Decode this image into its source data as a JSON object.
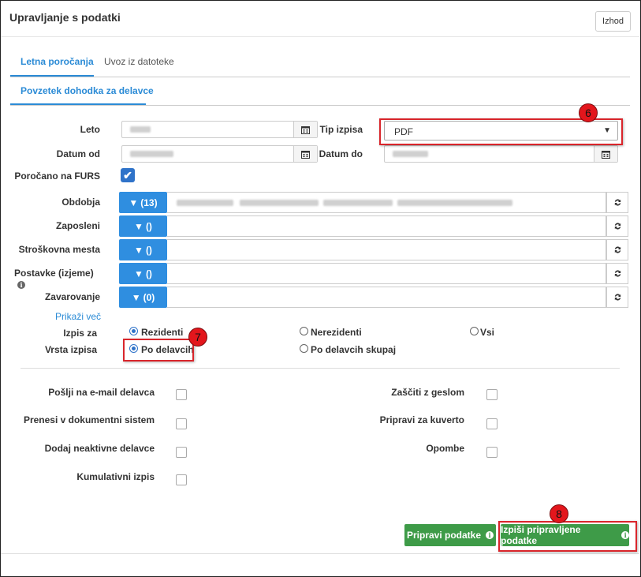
{
  "header": {
    "title": "Upravljanje s podatki",
    "exit_label": "Izhod"
  },
  "tabs": [
    {
      "label": "Letna poročanja"
    },
    {
      "label": "Uvoz iz datoteke"
    }
  ],
  "subtab": {
    "label": "Povzetek dohodka za delavce"
  },
  "form": {
    "leto_label": "Leto",
    "tip_izpisa_label": "Tip izpisa",
    "tip_izpisa_value": "PDF",
    "datum_od_label": "Datum od",
    "datum_do_label": "Datum do",
    "furs_label": "Poročano na FURS",
    "furs_check": "✔"
  },
  "filters": [
    {
      "label": "Obdobja",
      "count": "(13)"
    },
    {
      "label": "Zaposleni",
      "count": "()"
    },
    {
      "label": "Stroškovna mesta",
      "count": "()"
    },
    {
      "label": "Postavke (izjeme)",
      "count": "()"
    },
    {
      "label": "Zavarovanje",
      "count": "(0)"
    }
  ],
  "show_more": "Prikaži več",
  "izpis_za": {
    "label": "Izpis za",
    "options": [
      "Rezidenti",
      "Nerezidenti",
      "Vsi"
    ]
  },
  "vrsta_izpisa": {
    "label": "Vrsta izpisa",
    "options": [
      "Po delavcih",
      "Po delavcih skupaj"
    ]
  },
  "options_left": [
    "Pošlji na e-mail delavca",
    "Prenesi v dokumentni sistem",
    "Dodaj neaktivne delavce",
    "Kumulativni izpis"
  ],
  "options_right": [
    "Zaščiti z geslom",
    "Pripravi za kuverto",
    "Opombe"
  ],
  "buttons": {
    "prepare": "Pripravi podatke",
    "print": "Izpiši pripravljene podatke"
  },
  "badges": {
    "b6": "6",
    "b7": "7",
    "b8": "8"
  },
  "icons": {
    "calendar": "calendar-icon",
    "filter": "filter-icon",
    "refresh": "refresh-icon",
    "info": "info-icon",
    "chevron": "chevron-down-icon"
  },
  "colors": {
    "accent": "#2b8bd6",
    "filter_button": "#2f8ee0",
    "green_button": "#3e9b48",
    "highlight": "#d9252b"
  }
}
